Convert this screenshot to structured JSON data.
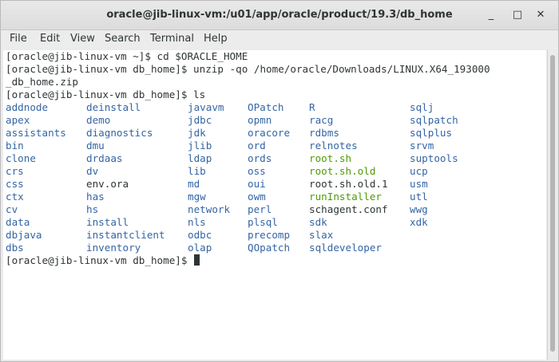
{
  "window": {
    "title": "oracle@jib-linux-vm:/u01/app/oracle/product/19.3/db_home",
    "buttons": {
      "minimize": "_",
      "maximize": "□",
      "close": "✕"
    }
  },
  "menu": [
    "File",
    "Edit",
    "View",
    "Search",
    "Terminal",
    "Help"
  ],
  "terminal": {
    "lines": [
      "[oracle@jib-linux-vm ~]$ cd $ORACLE_HOME",
      "[oracle@jib-linux-vm db_home]$ unzip -qo /home/oracle/Downloads/LINUX.X64_193000",
      "_db_home.zip",
      "[oracle@jib-linux-vm db_home]$ ls"
    ],
    "ls_rows": [
      [
        [
          "addnode",
          "dir"
        ],
        [
          "deinstall",
          "dir"
        ],
        [
          "javavm",
          "dir"
        ],
        [
          "OPatch",
          "dir"
        ],
        [
          "R",
          "dir"
        ],
        [
          "sqlj",
          "dir"
        ]
      ],
      [
        [
          "apex",
          "dir"
        ],
        [
          "demo",
          "dir"
        ],
        [
          "jdbc",
          "dir"
        ],
        [
          "opmn",
          "dir"
        ],
        [
          "racg",
          "dir"
        ],
        [
          "sqlpatch",
          "dir"
        ]
      ],
      [
        [
          "assistants",
          "dir"
        ],
        [
          "diagnostics",
          "dir"
        ],
        [
          "jdk",
          "dir"
        ],
        [
          "oracore",
          "dir"
        ],
        [
          "rdbms",
          "dir"
        ],
        [
          "sqlplus",
          "dir"
        ]
      ],
      [
        [
          "bin",
          "dir"
        ],
        [
          "dmu",
          "dir"
        ],
        [
          "jlib",
          "dir"
        ],
        [
          "ord",
          "dir"
        ],
        [
          "relnotes",
          "dir"
        ],
        [
          "srvm",
          "dir"
        ]
      ],
      [
        [
          "clone",
          "dir"
        ],
        [
          "drdaas",
          "dir"
        ],
        [
          "ldap",
          "dir"
        ],
        [
          "ords",
          "dir"
        ],
        [
          "root.sh",
          "exe"
        ],
        [
          "suptools",
          "dir"
        ]
      ],
      [
        [
          "crs",
          "dir"
        ],
        [
          "dv",
          "dir"
        ],
        [
          "lib",
          "dir"
        ],
        [
          "oss",
          "dir"
        ],
        [
          "root.sh.old",
          "exe"
        ],
        [
          "ucp",
          "dir"
        ]
      ],
      [
        [
          "css",
          "dir"
        ],
        [
          "env.ora",
          "plain"
        ],
        [
          "md",
          "dir"
        ],
        [
          "oui",
          "dir"
        ],
        [
          "root.sh.old.1",
          "plain"
        ],
        [
          "usm",
          "dir"
        ]
      ],
      [
        [
          "ctx",
          "dir"
        ],
        [
          "has",
          "dir"
        ],
        [
          "mgw",
          "dir"
        ],
        [
          "owm",
          "dir"
        ],
        [
          "runInstaller",
          "exe"
        ],
        [
          "utl",
          "dir"
        ]
      ],
      [
        [
          "cv",
          "dir"
        ],
        [
          "hs",
          "dir"
        ],
        [
          "network",
          "dir"
        ],
        [
          "perl",
          "dir"
        ],
        [
          "schagent.conf",
          "plain"
        ],
        [
          "wwg",
          "dir"
        ]
      ],
      [
        [
          "data",
          "dir"
        ],
        [
          "install",
          "dir"
        ],
        [
          "nls",
          "dir"
        ],
        [
          "plsql",
          "dir"
        ],
        [
          "sdk",
          "dir"
        ],
        [
          "xdk",
          "dir"
        ]
      ],
      [
        [
          "dbjava",
          "dir"
        ],
        [
          "instantclient",
          "dir"
        ],
        [
          "odbc",
          "dir"
        ],
        [
          "precomp",
          "dir"
        ],
        [
          "slax",
          "dir"
        ],
        [
          "",
          ""
        ]
      ],
      [
        [
          "dbs",
          "dir"
        ],
        [
          "inventory",
          "dir"
        ],
        [
          "olap",
          "dir"
        ],
        [
          "QOpatch",
          "dir"
        ],
        [
          "sqldeveloper",
          "dir"
        ],
        [
          "",
          ""
        ]
      ]
    ],
    "final_prompt": "[oracle@jib-linux-vm db_home]$ "
  },
  "colors": {
    "dir": "#3465a4",
    "exe": "#4e9a06",
    "text": "#2e3436",
    "background": "#ffffff"
  }
}
